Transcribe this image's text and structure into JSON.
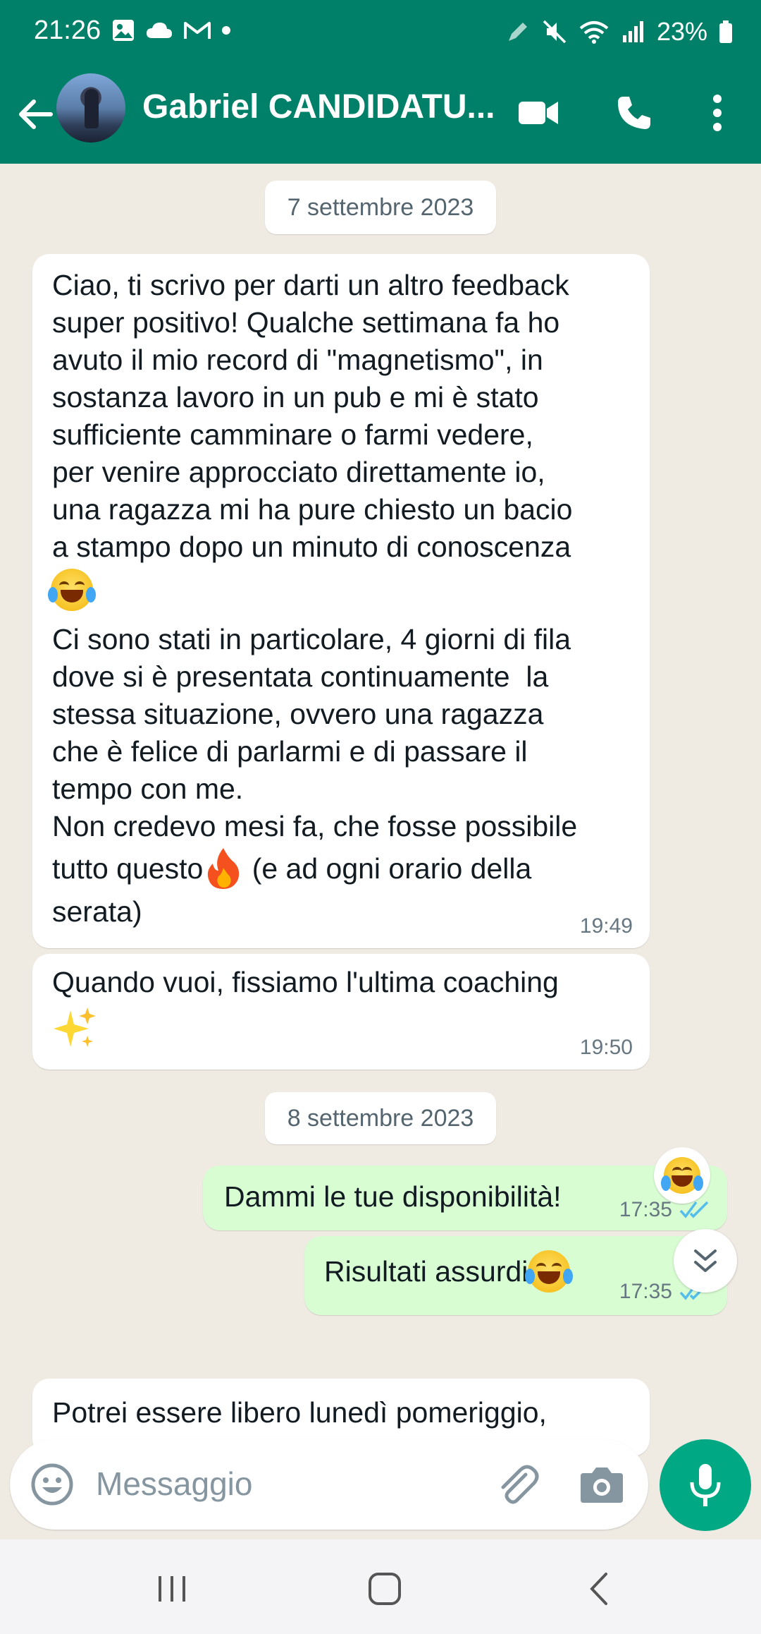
{
  "status_bar": {
    "time": "21:26",
    "battery": "23%"
  },
  "header": {
    "contact_name": "Gabriel CANDIDATU...",
    "icons": [
      "back-arrow-icon",
      "video-call-icon",
      "phone-icon",
      "more-vert-icon"
    ]
  },
  "chat": {
    "date_1": "7 settembre 2023",
    "msg_1": {
      "part_1": "Ciao, ti scrivo per darti un altro feedback\nsuper positivo! Qualche settimana fa ho\navuto il mio record di \"magnetismo\", in\nsostanza lavoro in un pub e mi è stato\nsufficiente camminare o farmi vedere,\nper venire approcciato direttamente io,\nuna ragazza mi ha pure chiesto un bacio\na stampo dopo un minuto di conoscenza",
      "part_2": "Ci sono stati in particolare, 4 giorni di fila\ndove si è presentata continuamente  la\nstessa situazione, ovvero una ragazza\nche è felice di parlarmi e di passare il\ntempo con me.\nNon credevo mesi fa, che fosse possibile",
      "part_3a": "tutto questo",
      "part_3b": " (e ad ogni orario della",
      "part_4": "serata)",
      "time": "19:49"
    },
    "msg_2": {
      "text": "Quando vuoi, fissiamo l'ultima coaching",
      "time": "19:50"
    },
    "date_2": "8 settembre 2023",
    "msg_3": {
      "text": "Dammi le tue disponibilità!",
      "time": "17:35"
    },
    "msg_4": {
      "text": "Risultati assurdi",
      "time": "17:35"
    },
    "msg_5": {
      "text": "Potrei essere libero lunedì pomeriggio,"
    }
  },
  "composer": {
    "placeholder": "Messaggio"
  },
  "colors": {
    "header_green": "#008069",
    "outgoing_bubble": "#d9fdd3",
    "incoming_bubble": "#ffffff",
    "read_ticks": "#53bdeb",
    "mic_button": "#00a884"
  }
}
